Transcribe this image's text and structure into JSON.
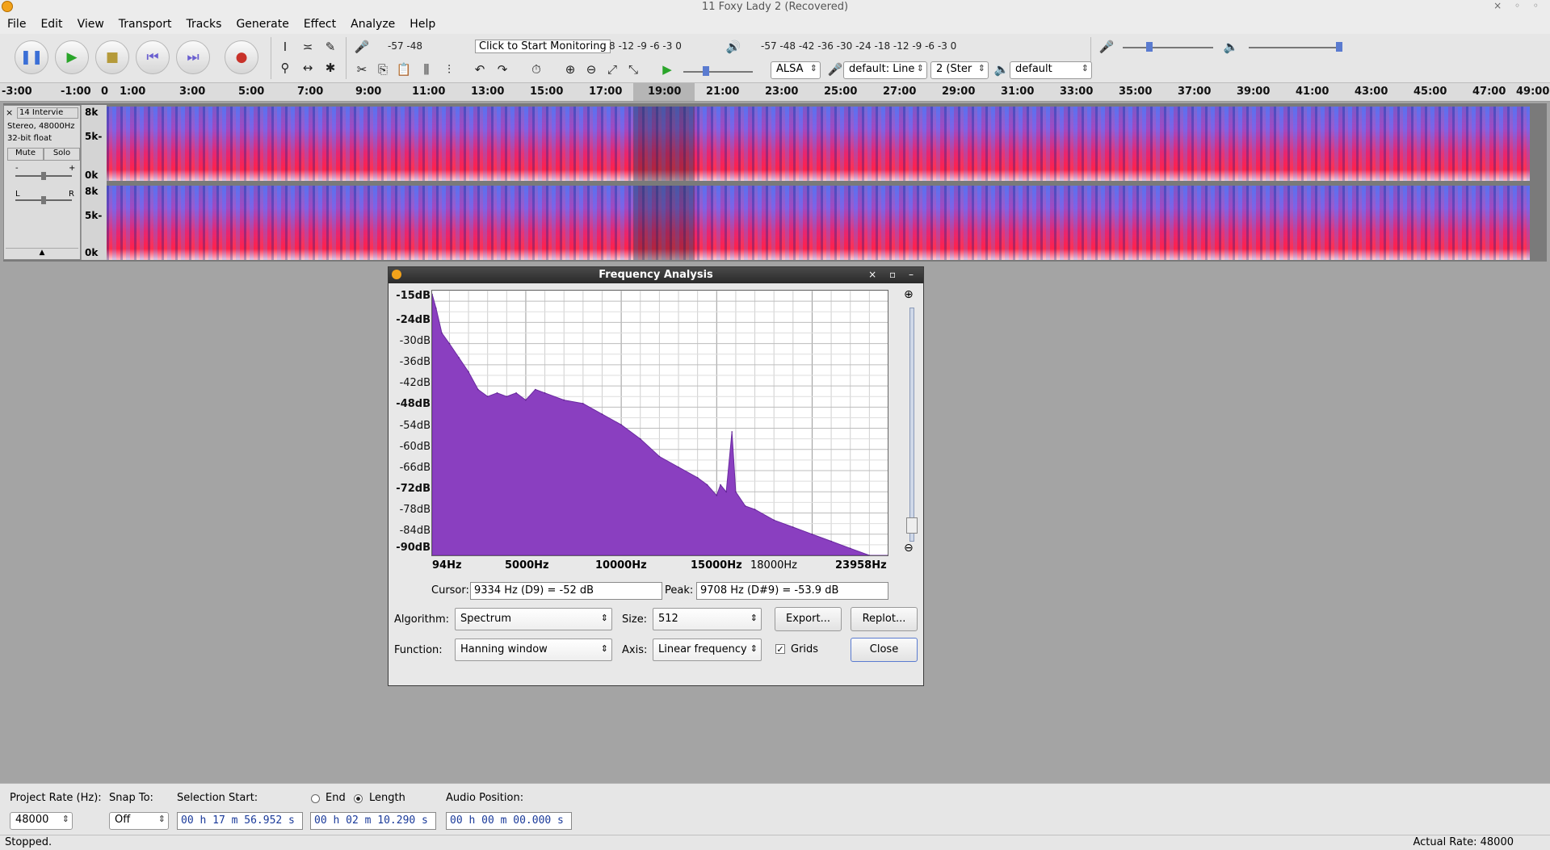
{
  "window": {
    "title": "11 Foxy Lady 2 (Recovered)",
    "controls": "× ◦ ◦"
  },
  "menu": [
    "File",
    "Edit",
    "View",
    "Transport",
    "Tracks",
    "Generate",
    "Effect",
    "Analyze",
    "Help"
  ],
  "transport": {
    "pause": "❚❚",
    "play": "▶",
    "stop": "■",
    "skip_start": "⏮",
    "skip_end": "⏭",
    "record": "●"
  },
  "meters": {
    "record_scale": "-57     -48",
    "monitor_prompt": "Click to Start Monitoring",
    "record_scale_right": "8   -12 -9  -6  -3  0",
    "play_scale": "-57     -48     -42     -36     -30     -24     -18     -12  -9  -6  -3  0"
  },
  "device": {
    "host": "ALSA",
    "recording": "default: Line",
    "channels": "2 (Ster",
    "playback": "default"
  },
  "ruler": {
    "labels": [
      "-3:00",
      "-1:00",
      "0",
      "1:00",
      "3:00",
      "5:00",
      "7:00",
      "9:00",
      "11:00",
      "13:00",
      "15:00",
      "17:00",
      "19:00",
      "21:00",
      "23:00",
      "25:00",
      "27:00",
      "29:00",
      "31:00",
      "33:00",
      "35:00",
      "37:00",
      "39:00",
      "41:00",
      "43:00",
      "45:00",
      "47:00",
      "49:00"
    ]
  },
  "track": {
    "name": "14 Intervie",
    "info1": "Stereo, 48000Hz",
    "info2": "32-bit float",
    "mute": "Mute",
    "solo": "Solo",
    "gain_minus": "-",
    "gain_plus": "+",
    "pan_left": "L",
    "pan_right": "R",
    "scale": [
      "8k",
      "5k-",
      "0k"
    ]
  },
  "dialog": {
    "title": "Frequency Analysis",
    "ylabels": [
      "-15dB",
      "-24dB",
      "-30dB",
      "-36dB",
      "-42dB",
      "-48dB",
      "-54dB",
      "-60dB",
      "-66dB",
      "-72dB",
      "-78dB",
      "-84dB",
      "-90dB"
    ],
    "xlabels": [
      "94Hz",
      "5000Hz",
      "10000Hz",
      "15000Hz",
      "18000Hz",
      "23958Hz"
    ],
    "cursor_label": "Cursor:",
    "cursor_value": "9334 Hz (D9) = -52 dB",
    "peak_label": "Peak:",
    "peak_value": "9708 Hz (D#9) = -53.9 dB",
    "algorithm_label": "Algorithm:",
    "algorithm_value": "Spectrum",
    "size_label": "Size:",
    "size_value": "512",
    "function_label": "Function:",
    "function_value": "Hanning window",
    "axis_label": "Axis:",
    "axis_value": "Linear frequency",
    "grids_label": "Grids",
    "export": "Export...",
    "replot": "Replot...",
    "close": "Close"
  },
  "chart_data": {
    "type": "area",
    "title": "",
    "xlabel": "",
    "ylabel": "",
    "xlim": [
      94,
      23958
    ],
    "ylim": [
      -90,
      -15
    ],
    "grid": true,
    "x": [
      94,
      300,
      600,
      1000,
      1500,
      2000,
      2500,
      3000,
      3500,
      4000,
      4500,
      5000,
      5500,
      6000,
      7000,
      8000,
      9000,
      10000,
      11000,
      12000,
      13000,
      14000,
      14500,
      15000,
      15200,
      15500,
      15800,
      16000,
      16500,
      17000,
      18000,
      19000,
      20000,
      21000,
      22000,
      23000,
      23958
    ],
    "y": [
      -16,
      -20,
      -27,
      -30,
      -34,
      -38,
      -43,
      -45,
      -44,
      -45,
      -44,
      -46,
      -43,
      -44,
      -46,
      -47,
      -50,
      -53,
      -57,
      -62,
      -65,
      -68,
      -70,
      -73,
      -70,
      -72,
      -55,
      -72,
      -76,
      -77,
      -80,
      -82,
      -84,
      -86,
      -88,
      -90,
      -90
    ]
  },
  "selection": {
    "rate_label": "Project Rate (Hz):",
    "rate_value": "48000",
    "snap_label": "Snap To:",
    "snap_value": "Off",
    "sel_start_label": "Selection Start:",
    "end_label": "End",
    "length_label": "Length",
    "start_value": "00 h 17 m 56.952 s",
    "length_value": "00 h 02 m 10.290 s",
    "audio_pos_label": "Audio Position:",
    "audio_pos_value": "00 h 00 m 00.000 s"
  },
  "status": {
    "left": "Stopped.",
    "right": "Actual Rate: 48000"
  }
}
